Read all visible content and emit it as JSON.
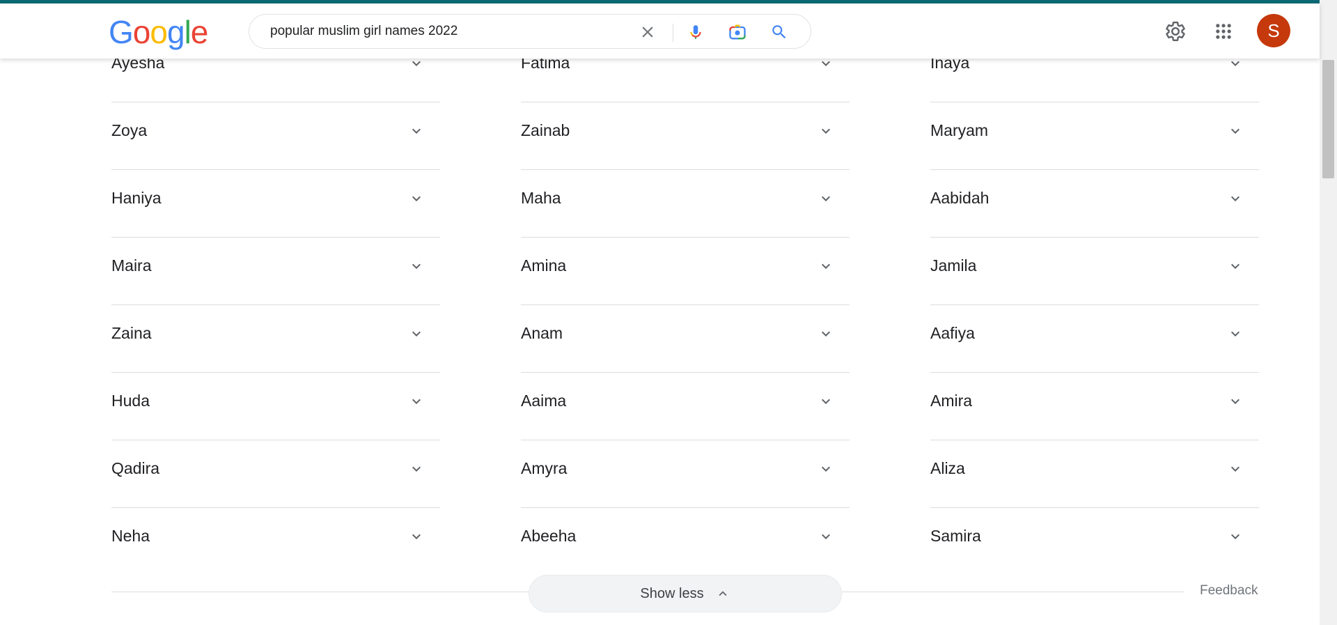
{
  "header": {
    "logo": [
      "G",
      "o",
      "o",
      "g",
      "l",
      "e"
    ],
    "logo_colors": [
      "#4285f4",
      "#ea4335",
      "#fbbc05",
      "#4285f4",
      "#34a853",
      "#ea4335"
    ],
    "search_value": "popular muslim girl names 2022",
    "avatar_letter": "S",
    "avatar_color": "#c5390c",
    "accent_color": "#0c6a74"
  },
  "names": {
    "col1": [
      "Ayesha",
      "Zoya",
      "Haniya",
      "Maira",
      "Zaina",
      "Huda",
      "Qadira",
      "Neha"
    ],
    "col2": [
      "Fatima",
      "Zainab",
      "Maha",
      "Amina",
      "Anam",
      "Aaima",
      "Amyra",
      "Abeeha"
    ],
    "col3": [
      "Inaya",
      "Maryam",
      "Aabidah",
      "Jamila",
      "Aafiya",
      "Amira",
      "Aliza",
      "Samira"
    ]
  },
  "footer": {
    "show_less_label": "Show less",
    "feedback_label": "Feedback"
  },
  "icons": {
    "clear": "close-icon",
    "voice": "microphone-icon",
    "lens": "camera-icon",
    "search": "search-icon",
    "settings": "gear-icon",
    "apps": "apps-grid-icon",
    "expand": "chevron-down-icon",
    "collapse": "chevron-up-icon"
  }
}
